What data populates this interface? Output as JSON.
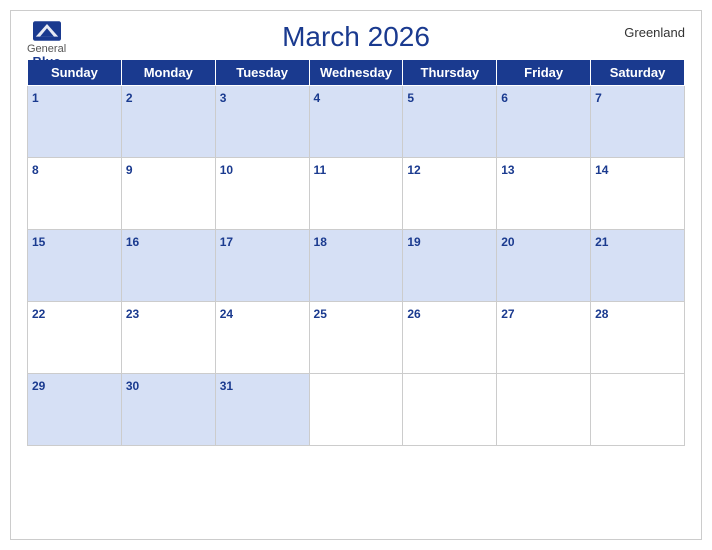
{
  "calendar": {
    "month_title": "March 2026",
    "region": "Greenland",
    "days_of_week": [
      "Sunday",
      "Monday",
      "Tuesday",
      "Wednesday",
      "Thursday",
      "Friday",
      "Saturday"
    ],
    "weeks": [
      [
        1,
        2,
        3,
        4,
        5,
        6,
        7
      ],
      [
        8,
        9,
        10,
        11,
        12,
        13,
        14
      ],
      [
        15,
        16,
        17,
        18,
        19,
        20,
        21
      ],
      [
        22,
        23,
        24,
        25,
        26,
        27,
        28
      ],
      [
        29,
        30,
        31,
        null,
        null,
        null,
        null
      ]
    ]
  },
  "logo": {
    "general": "General",
    "blue": "Blue"
  }
}
